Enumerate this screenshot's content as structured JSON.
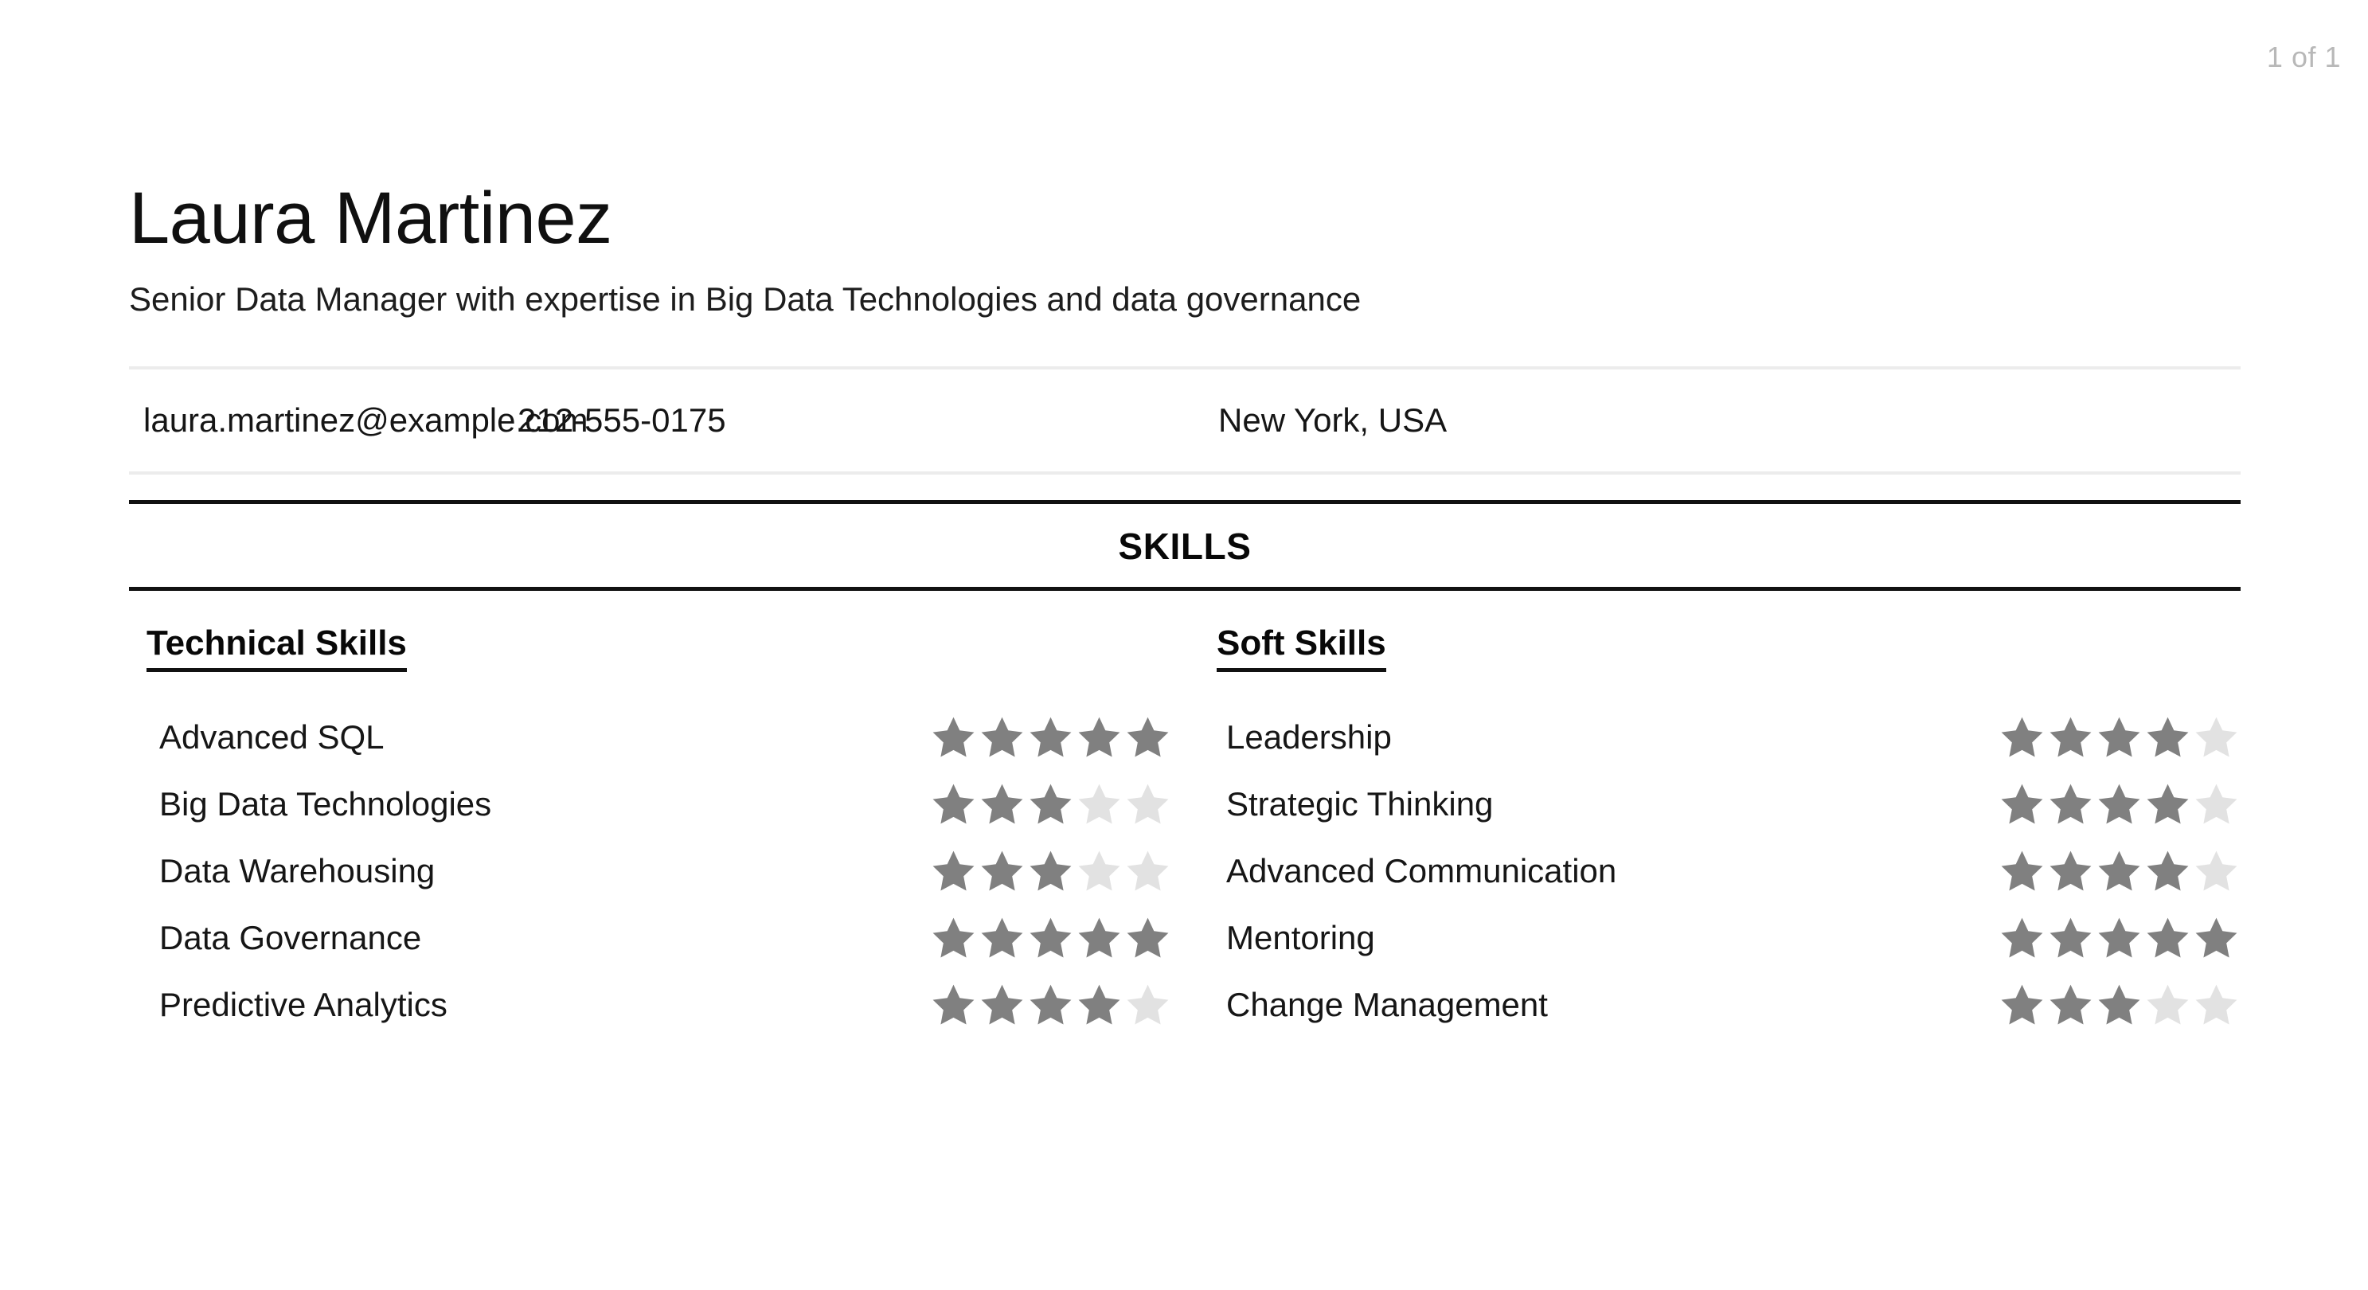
{
  "page": {
    "indicator": "1 of 1"
  },
  "header": {
    "name": "Laura Martinez",
    "headline": "Senior Data Manager with expertise in Big Data Technologies and data governance"
  },
  "contact": {
    "email": "laura.martinez@example.com",
    "phone": "212-555-0175",
    "location": "New York, USA"
  },
  "section": {
    "title": "SKILLS"
  },
  "technical": {
    "heading": "Technical Skills",
    "items": [
      {
        "name": "Advanced SQL",
        "rating": 5
      },
      {
        "name": "Big Data Technologies",
        "rating": 3
      },
      {
        "name": "Data Warehousing",
        "rating": 3
      },
      {
        "name": "Data Governance",
        "rating": 5
      },
      {
        "name": "Predictive Analytics",
        "rating": 4
      }
    ]
  },
  "soft": {
    "heading": "Soft Skills",
    "items": [
      {
        "name": "Leadership",
        "rating": 4
      },
      {
        "name": "Strategic Thinking",
        "rating": 4
      },
      {
        "name": "Advanced Communication",
        "rating": 4
      },
      {
        "name": "Mentoring",
        "rating": 5
      },
      {
        "name": "Change Management",
        "rating": 3
      }
    ]
  },
  "rating_scale": 5,
  "colors": {
    "star_filled": "#808080",
    "star_empty": "#e2e2e2",
    "rule_dark": "#111111",
    "rule_light": "#ececec",
    "page_indicator": "#b8b8b8"
  }
}
